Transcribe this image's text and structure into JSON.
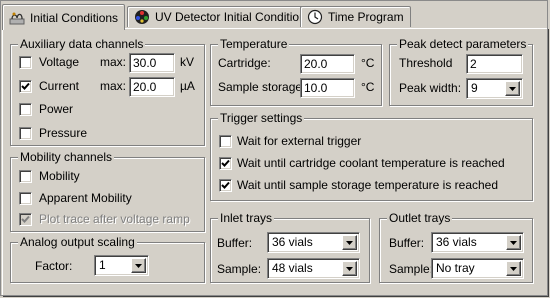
{
  "tabs": [
    {
      "label": "Initial Conditions",
      "icon": "conditions-icon",
      "active": true
    },
    {
      "label": "UV Detector Initial Conditions",
      "icon": "uv-detector-icon",
      "active": false
    },
    {
      "label": "Time Program",
      "icon": "clock-icon",
      "active": false
    }
  ],
  "auxiliary": {
    "title": "Auxiliary data channels",
    "max_label": "max:",
    "voltage": {
      "label": "Voltage",
      "checked": false,
      "max": "30.0",
      "unit": "kV"
    },
    "current": {
      "label": "Current",
      "checked": true,
      "max": "20.0",
      "unit": "µA"
    },
    "power": {
      "label": "Power",
      "checked": false
    },
    "pressure": {
      "label": "Pressure",
      "checked": false
    }
  },
  "mobility": {
    "title": "Mobility channels",
    "mobility": {
      "label": "Mobility",
      "checked": false
    },
    "apparent": {
      "label": "Apparent Mobility",
      "checked": false
    },
    "plot_trace": {
      "label": "Plot trace after voltage ramp",
      "checked": true,
      "disabled": true
    }
  },
  "analog": {
    "title": "Analog output scaling",
    "factor_label": "Factor:",
    "factor_value": "1"
  },
  "temperature": {
    "title": "Temperature",
    "cartridge_label": "Cartridge:",
    "cartridge_value": "20.0",
    "storage_label": "Sample storage:",
    "storage_value": "10.0",
    "unit": "°C"
  },
  "peak": {
    "title": "Peak detect parameters",
    "threshold_label": "Threshold",
    "threshold_value": "2",
    "width_label": "Peak width:",
    "width_value": "9"
  },
  "trigger": {
    "title": "Trigger settings",
    "external": {
      "label": "Wait for external trigger",
      "checked": false
    },
    "coolant": {
      "label": "Wait until cartridge coolant temperature is reached",
      "checked": true
    },
    "storage": {
      "label": "Wait until sample storage temperature is reached",
      "checked": true
    }
  },
  "inlet": {
    "title": "Inlet trays",
    "buffer_label": "Buffer:",
    "buffer_value": "36 vials",
    "sample_label": "Sample:",
    "sample_value": "48 vials"
  },
  "outlet": {
    "title": "Outlet trays",
    "buffer_label": "Buffer:",
    "buffer_value": "36 vials",
    "sample_label": "Sample:",
    "sample_value": "No tray"
  }
}
